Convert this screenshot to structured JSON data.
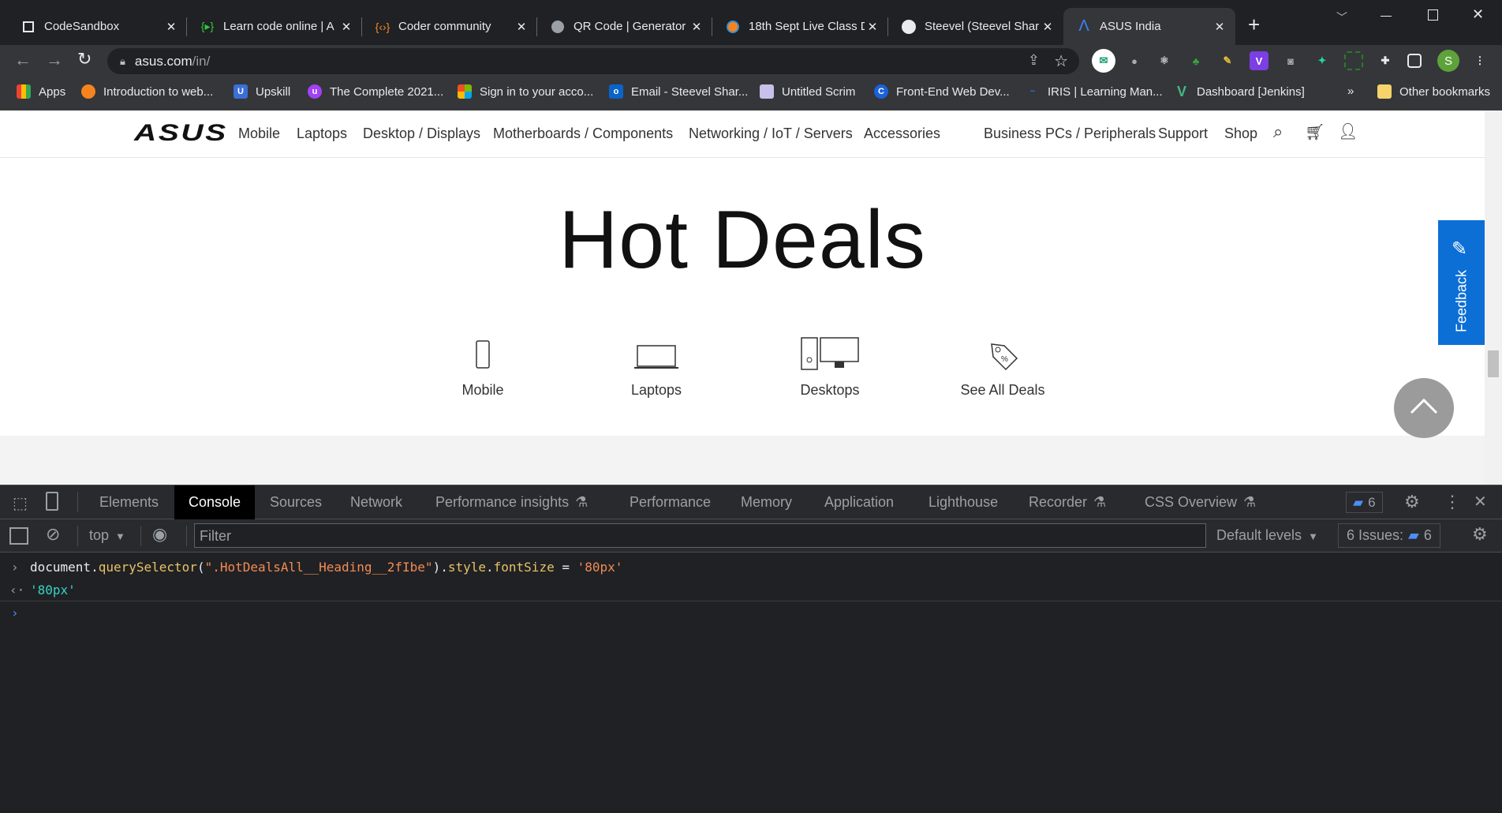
{
  "browser": {
    "tabs": [
      {
        "title": "CodeSandbox",
        "icon": "codesandbox-icon"
      },
      {
        "title": "Learn code online | A",
        "icon": "braces-play-icon"
      },
      {
        "title": "Coder community",
        "icon": "braces-icon"
      },
      {
        "title": "QR Code | Generator",
        "icon": "globe-icon"
      },
      {
        "title": "18th Sept Live Class D",
        "icon": "orange-circle-icon"
      },
      {
        "title": "Steevel (Steevel Sharma",
        "icon": "github-icon"
      },
      {
        "title": "ASUS India",
        "icon": "asus-a-icon",
        "active": true
      }
    ],
    "new_tab": "+",
    "url_host": "asus.com",
    "url_path": "/in/",
    "profile_initial": "S",
    "bookmarks": [
      {
        "label": "Apps",
        "color": "#e94235"
      },
      {
        "label": "Introduction to web...",
        "color": "#f5841f"
      },
      {
        "label": "Upskill",
        "color": "#3b6fd8"
      },
      {
        "label": "The Complete 2021...",
        "color": "#a142f4"
      },
      {
        "label": "Sign in to your acco...",
        "color": "#f25022"
      },
      {
        "label": "Email - Steevel Shar...",
        "color": "#0a64c8"
      },
      {
        "label": "Untitled Scrim",
        "color": "#c8c0e8"
      },
      {
        "label": "Front-End Web Dev...",
        "color": "#1a62d8"
      },
      {
        "label": "IRIS | Learning Man...",
        "color": "#2a7ad8"
      },
      {
        "label": "Dashboard [Jenkins]",
        "color": "#42b883"
      }
    ],
    "more_bookmarks": "»",
    "other_bookmarks": "Other bookmarks"
  },
  "site": {
    "logo": "ASUS",
    "nav": [
      "Mobile",
      "Laptops",
      "Desktop / Displays",
      "Motherboards / Components",
      "Networking / IoT / Servers",
      "Accessories",
      "Business PCs / Peripherals",
      "Support",
      "Shop"
    ],
    "heading": "Hot Deals",
    "deals": [
      "Mobile",
      "Laptops",
      "Desktops",
      "See All Deals"
    ],
    "feedback": "Feedback"
  },
  "devtools": {
    "tabs": [
      "Elements",
      "Console",
      "Sources",
      "Network",
      "Performance insights",
      "Performance",
      "Memory",
      "Application",
      "Lighthouse",
      "Recorder",
      "CSS Overview"
    ],
    "active_tab": "Console",
    "messages_count": "6",
    "context": "top",
    "filter_placeholder": "Filter",
    "levels": "Default levels",
    "issues_label": "6 Issues:",
    "issues_count": "6",
    "console": {
      "input": {
        "obj": "document",
        "method": "querySelector",
        "arg": "\".HotDealsAll__Heading__2fIbe\"",
        "prop1": "style",
        "prop2": "fontSize",
        "op": " = ",
        "value": "'80px'"
      },
      "result": "'80px'"
    },
    "colors": {
      "string": "#f28b54",
      "method": "#e8c266",
      "result": "#35d4c7",
      "prompt": "#4d8ef7"
    }
  }
}
